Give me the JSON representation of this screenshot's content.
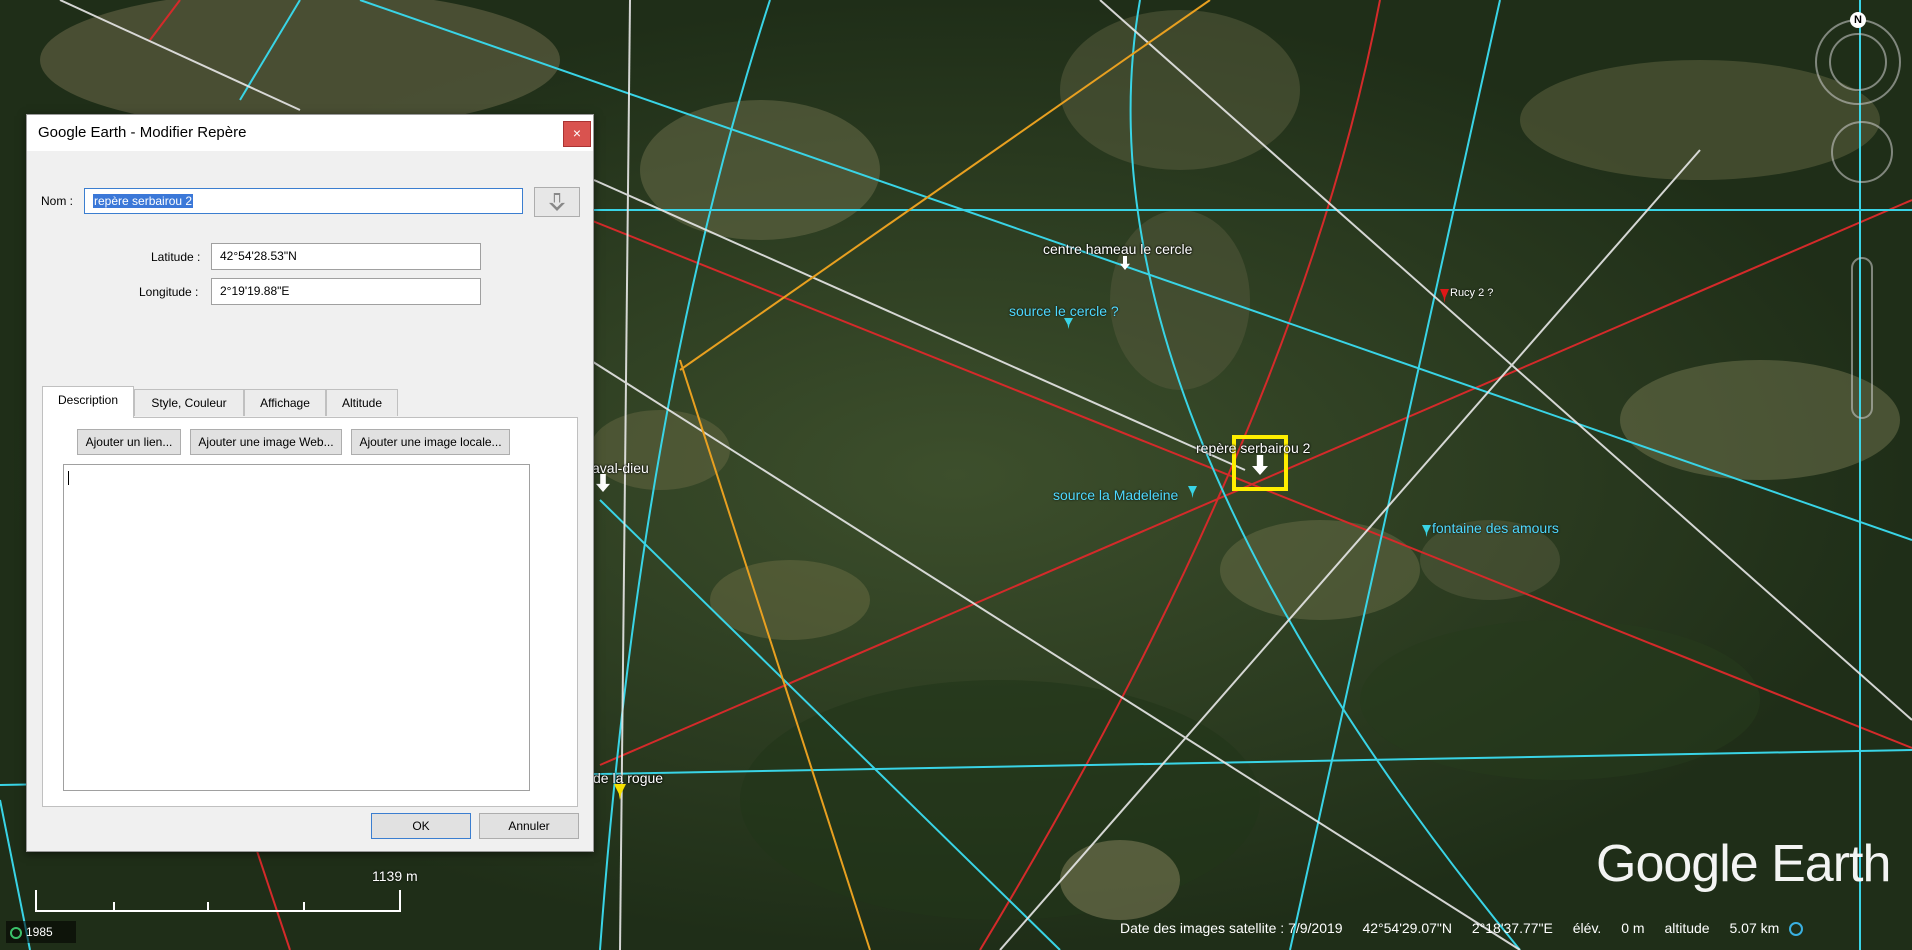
{
  "dialog": {
    "title": "Google Earth - Modifier Repère",
    "close_symbol": "×",
    "name_label": "Nom :",
    "name_value": "repère serbairou 2",
    "latitude_label": "Latitude :",
    "latitude_value": "42°54'28.53\"N",
    "longitude_label": "Longitude :",
    "longitude_value": "2°19'19.88\"E",
    "tabs": [
      {
        "label": "Description"
      },
      {
        "label": "Style, Couleur"
      },
      {
        "label": "Affichage"
      },
      {
        "label": "Altitude"
      }
    ],
    "buttons": {
      "add_link": "Ajouter un lien...",
      "add_web_image": "Ajouter une image Web...",
      "add_local_image": "Ajouter une image locale...",
      "ok": "OK",
      "cancel": "Annuler"
    }
  },
  "map": {
    "labels": {
      "centre_hameau": "centre hameau le cercle",
      "source_cercle": "source le cercle ?",
      "rucy": "Rucy 2 ?",
      "repere": "repère serbairou 2",
      "source_madeleine": "source la Madeleine",
      "fontaine": "fontaine des amours",
      "laval_dieu": "aval-dieu",
      "de_la_rogue": "de la rogue"
    },
    "scale": "1139  m",
    "year": "1985",
    "logo": "Google Earth",
    "compass_letter": "N"
  },
  "status": {
    "imagery_date": "Date des images satellite : 7/9/2019",
    "lat": "42°54'29.07\"N",
    "lon": "2°18'37.77\"E",
    "elev_label": "élév.",
    "elev_value": "0 m",
    "alt_label": "altitude",
    "alt_value": "5.07 km"
  },
  "colors": {
    "red_line": "#d42a2a",
    "cyan_line": "#39d4e6",
    "white_line": "#e8e8e8",
    "orange_line": "#e8a020",
    "highlight": "#ffee00"
  }
}
